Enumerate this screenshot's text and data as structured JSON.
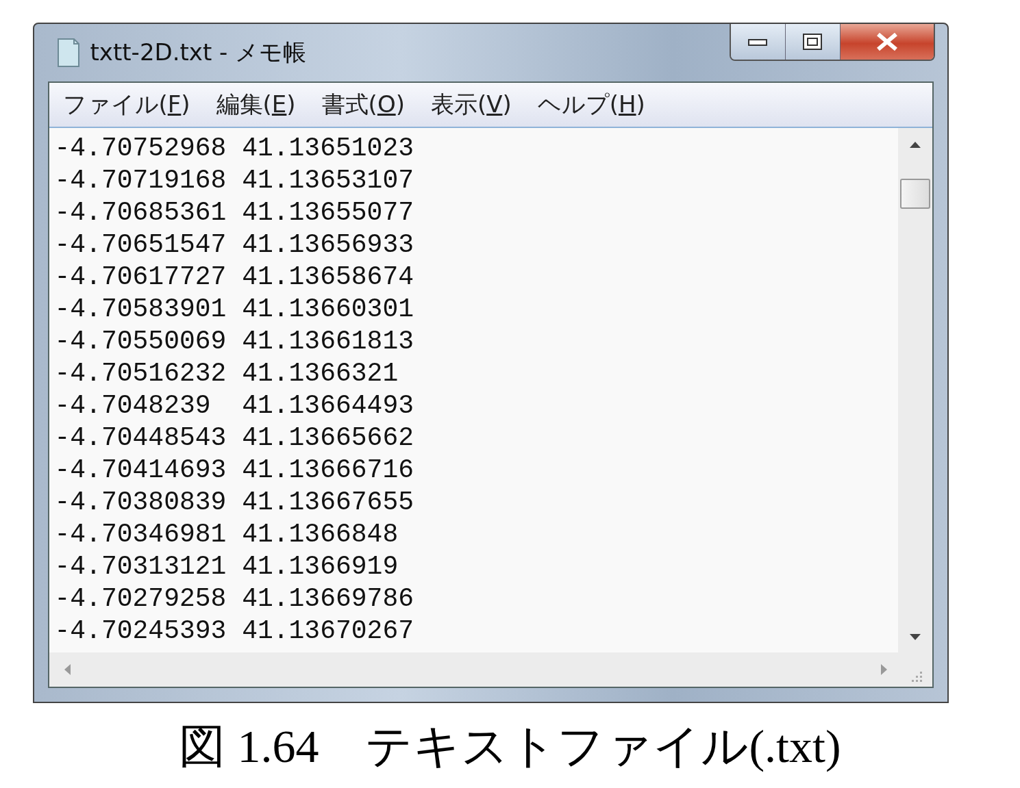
{
  "window": {
    "title": "txtt-2D.txt - メモ帳"
  },
  "menu": [
    {
      "before": "ファイル(",
      "access_key": "F",
      "after": ")"
    },
    {
      "before": "編集(",
      "access_key": "E",
      "after": ")"
    },
    {
      "before": "書式(",
      "access_key": "O",
      "after": ")"
    },
    {
      "before": "表示(",
      "access_key": "V",
      "after": ")"
    },
    {
      "before": "ヘルプ(",
      "access_key": "H",
      "after": ")"
    }
  ],
  "lines": [
    "-4.70752968 41.13651023",
    "-4.70719168 41.13653107",
    "-4.70685361 41.13655077",
    "-4.70651547 41.13656933",
    "-4.70617727 41.13658674",
    "-4.70583901 41.13660301",
    "-4.70550069 41.13661813",
    "-4.70516232 41.1366321",
    "-4.7048239  41.13664493",
    "-4.70448543 41.13665662",
    "-4.70414693 41.13666716",
    "-4.70380839 41.13667655",
    "-4.70346981 41.1366848",
    "-4.70313121 41.1366919",
    "-4.70279258 41.13669786",
    "-4.70245393 41.13670267"
  ],
  "caption": "図 1.64　テキストファイル(.txt)"
}
